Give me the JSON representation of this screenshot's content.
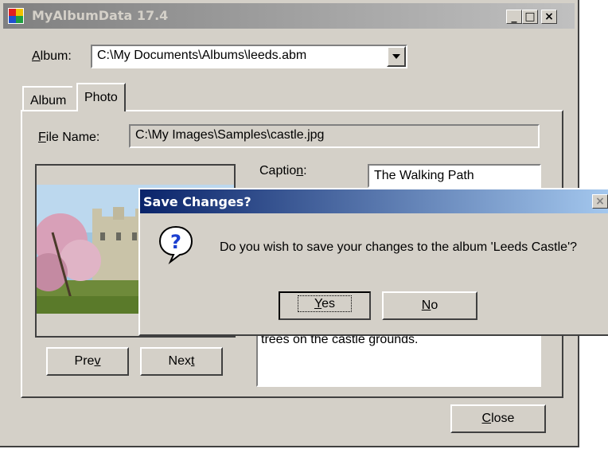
{
  "window": {
    "title": "MyAlbumData 17.4",
    "minimize": "_",
    "maximize": "□",
    "close": "×"
  },
  "album": {
    "label_prefix": "A",
    "label_rest": "lbum:",
    "value": "C:\\My Documents\\Albums\\leeds.abm"
  },
  "tabs": [
    {
      "label": "Album"
    },
    {
      "label": "Photo"
    }
  ],
  "photo": {
    "file_name_prefix": "F",
    "file_name_rest": "ile Name:",
    "file_name_value": "C:\\My Images\\Samples\\castle.jpg",
    "caption_prefix": "Captio",
    "caption_key": "n",
    "caption_suffix": ":",
    "caption_value": "The Walking Path",
    "description_value": "trees on the castle grounds.",
    "prev_prefix": "Pre",
    "prev_key": "v",
    "next_prefix": "Nex",
    "next_key": "t"
  },
  "footer": {
    "close_key": "C",
    "close_rest": "lose"
  },
  "dialog": {
    "title": "Save Changes?",
    "message": "Do you wish to save your changes to the album 'Leeds Castle'?",
    "yes_key": "Y",
    "yes_rest": "es",
    "no_key": "N",
    "no_rest": "o",
    "close": "×",
    "icon_glyph": "?"
  },
  "colors": {
    "dialog_title_start": "#0a246a",
    "window_title_inactive": "#808080",
    "question_icon": "#1c3fd0"
  }
}
